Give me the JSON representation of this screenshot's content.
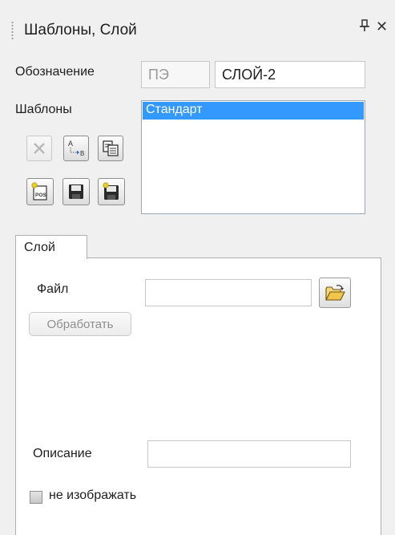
{
  "panel": {
    "title": "Шаблоны, Слой",
    "pin_glyph": "ᵰ",
    "close_glyph": "✕"
  },
  "designation": {
    "label": "Обозначение",
    "prefix_value": "ПЭ",
    "value": "СЛОЙ-2"
  },
  "templates": {
    "label": "Шаблоны",
    "items": [
      "Стандарт"
    ],
    "selected_index": 0,
    "toolbar_icons": [
      "delete-icon",
      "rename-ab-icon",
      "copy-icon",
      "new-pos-icon",
      "save-icon",
      "save-as-icon"
    ]
  },
  "tabs": [
    {
      "label": "Слой",
      "active": true
    }
  ],
  "layer": {
    "file_label": "Файл",
    "file_value": "",
    "process_button": "Обработать",
    "description_label": "Описание",
    "description_value": "",
    "hide_checkbox_label": "не изображать",
    "hide_checked": false
  },
  "colors": {
    "selection": "#3399ff",
    "background": "#f0f0f0"
  }
}
